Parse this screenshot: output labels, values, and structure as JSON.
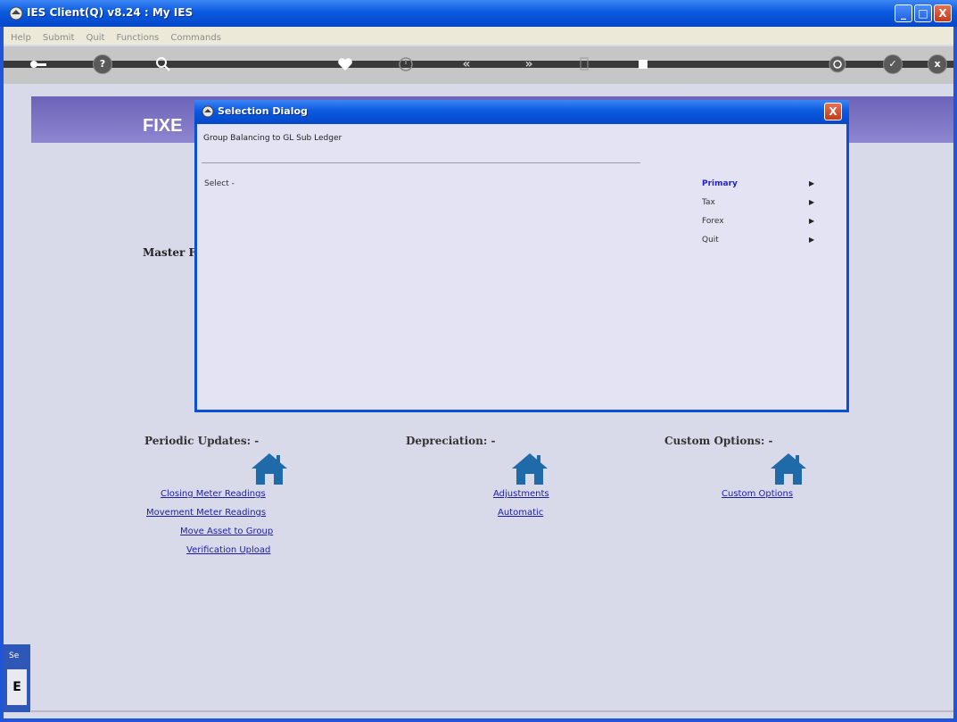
{
  "window": {
    "title": "IES Client(Q) v8.24 : My IES",
    "minimize_label": "_",
    "maximize_label": "□",
    "close_label": "X"
  },
  "menubar": {
    "items": [
      "Help",
      "Submit",
      "Quit",
      "Functions",
      "Commands"
    ]
  },
  "toolbar": {
    "icons": [
      "key-icon",
      "help-icon",
      "search-icon",
      "heart-icon",
      "clock-icon",
      "back-icon",
      "forward-icon",
      "page-icon",
      "stop-icon",
      "refresh-icon",
      "check-icon",
      "cancel-icon"
    ],
    "glyphs": {
      "back": "«",
      "forward": "»",
      "help": "?",
      "check": "✓",
      "cancel": "x"
    }
  },
  "page": {
    "banner_title": "FIXE",
    "master_fragment": "Master F",
    "left_tab_label": "Se",
    "left_tab_glyph": "E"
  },
  "sections": {
    "periodic": {
      "title": "Periodic Updates: -",
      "links": [
        "Closing Meter Readings",
        "Movement Meter Readings",
        "Move Asset to Group",
        "Verification Upload"
      ]
    },
    "depreciation": {
      "title": "Depreciation: -",
      "links": [
        "Adjustments",
        "Automatic"
      ]
    },
    "custom": {
      "title": "Custom Options: -",
      "links": [
        "Custom Options"
      ]
    }
  },
  "dialog": {
    "title": "Selection Dialog",
    "subtitle": "Group Balancing to GL Sub Ledger",
    "select_label": "Select -",
    "close_label": "X",
    "options": [
      {
        "label": "Primary",
        "active": true
      },
      {
        "label": "Tax",
        "active": false
      },
      {
        "label": "Forex",
        "active": false
      },
      {
        "label": "Quit",
        "active": false
      }
    ],
    "arrow_glyph": "▶"
  },
  "colors": {
    "titlebar": "#0a5ae0",
    "banner": "#7a72c2",
    "link": "#1d1da6",
    "page_bg": "#d9dae9",
    "dialog_bg": "#e3e3f4"
  }
}
